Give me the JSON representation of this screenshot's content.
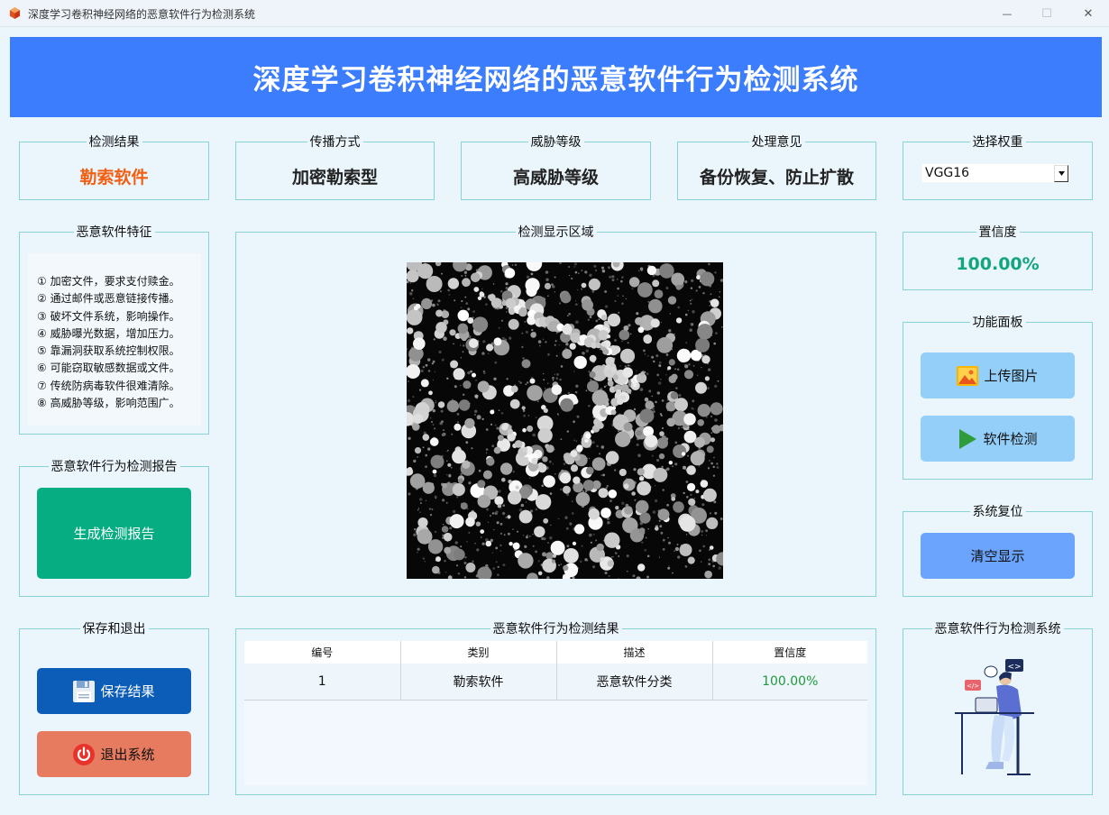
{
  "window": {
    "title": "深度学习卷积神经网络的恶意软件行为检测系统",
    "controls": {
      "minimize": "—",
      "maximize": "☐",
      "close": "✕"
    }
  },
  "header": {
    "title": "深度学习卷积神经网络的恶意软件行为检测系统"
  },
  "summary": {
    "result": {
      "label": "检测结果",
      "value": "勒索软件",
      "color": "#f25f12"
    },
    "spread": {
      "label": "传播方式",
      "value": "加密勒索型"
    },
    "threat": {
      "label": "威胁等级",
      "value": "高威胁等级"
    },
    "advice": {
      "label": "处理意见",
      "value": "备份恢复、防止扩散"
    },
    "weights": {
      "label": "选择权重",
      "selected": "VGG16"
    }
  },
  "features": {
    "title": "恶意软件特征",
    "items": [
      "① 加密文件，要求支付赎金。",
      "② 通过邮件或恶意链接传播。",
      "③ 破坏文件系统，影响操作。",
      "④ 威胁曝光数据，增加压力。",
      "⑤ 靠漏洞获取系统控制权限。",
      "⑥ 可能窃取敏感数据或文件。",
      "⑦ 传统防病毒软件很难清除。",
      "⑧ 高威胁等级，影响范围广。"
    ]
  },
  "display": {
    "title": "检测显示区域"
  },
  "confidence": {
    "label": "置信度",
    "value": "100.00%",
    "color": "#12a57e"
  },
  "panel": {
    "title": "功能面板",
    "upload": "上传图片",
    "detect": "软件检测"
  },
  "reset": {
    "title": "系统复位",
    "clear": "清空显示"
  },
  "report": {
    "title": "恶意软件行为检测报告",
    "button": "生成检测报告"
  },
  "save_exit": {
    "title": "保存和退出",
    "save": "保存结果",
    "exit": "退出系统"
  },
  "results": {
    "title": "恶意软件行为检测结果",
    "columns": [
      "编号",
      "类别",
      "描述",
      "置信度"
    ],
    "rows": [
      {
        "id": "1",
        "category": "勒索软件",
        "desc": "恶意软件分类",
        "conf": "100.00%"
      }
    ]
  },
  "branding": {
    "title": "恶意软件行为检测系统"
  },
  "colors": {
    "header": "#3c7dfe",
    "report_button": "#06ad82",
    "save_button": "#0b5db8",
    "exit_button": "#e77b60",
    "panel_button": "#94cff9",
    "clear_button": "#6ba4fc",
    "confidence_text": "#12a57e"
  }
}
